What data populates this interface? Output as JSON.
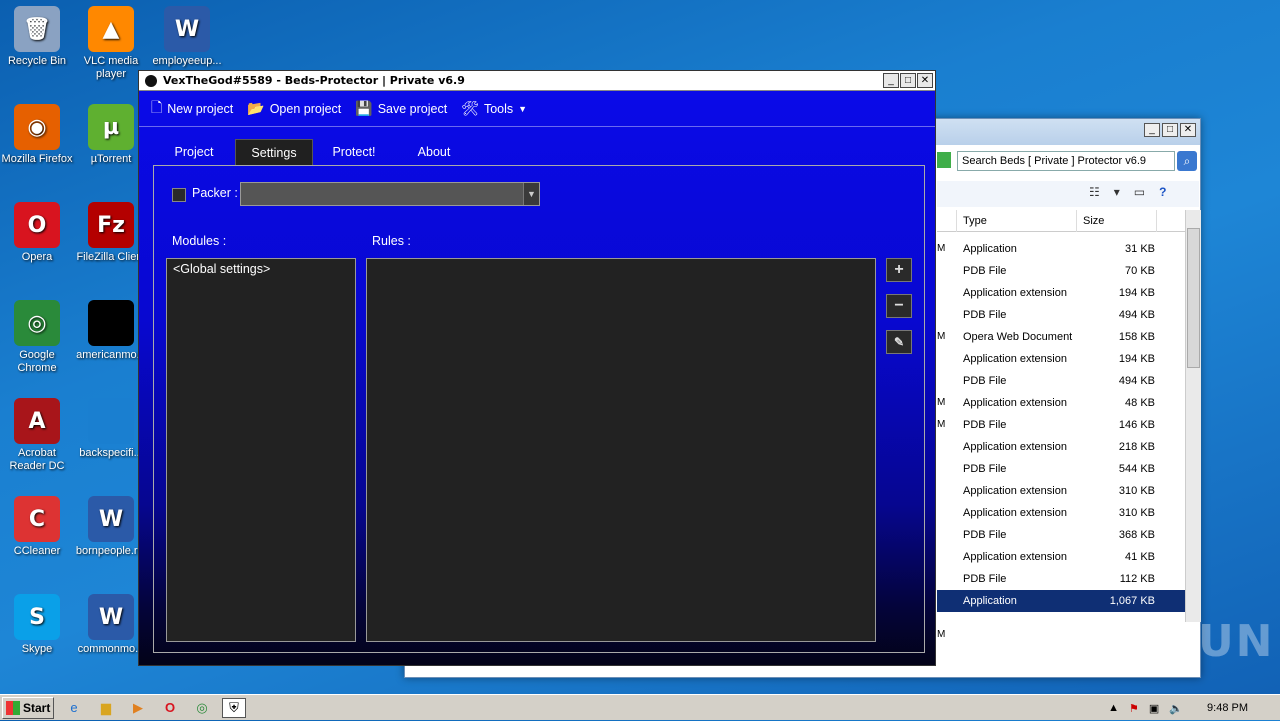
{
  "desktop": {
    "icons": [
      {
        "label": "Recycle Bin",
        "icon": "recycle-bin-icon",
        "glyph": "🗑",
        "color": "#8aa2c2"
      },
      {
        "label": "VLC media player",
        "icon": "vlc-icon",
        "glyph": "▲",
        "color": "#ff8800"
      },
      {
        "label": "employeeup...",
        "icon": "word-doc-icon",
        "glyph": "W",
        "color": "#2b5aa8"
      },
      {
        "label": "Mozilla Firefox",
        "icon": "firefox-icon",
        "glyph": "◉",
        "color": "#e66000"
      },
      {
        "label": "µTorrent",
        "icon": "utorrent-icon",
        "glyph": "µ",
        "color": "#5fb030"
      },
      {
        "label": "Opera",
        "icon": "opera-icon",
        "glyph": "O",
        "color": "#d8141f"
      },
      {
        "label": "FileZilla Client",
        "icon": "filezilla-icon",
        "glyph": "Fz",
        "color": "#b40000"
      },
      {
        "label": "Google Chrome",
        "icon": "chrome-icon",
        "glyph": "◎",
        "color": "#2a8a3a"
      },
      {
        "label": "americanmo...",
        "icon": "black-file-icon",
        "glyph": "",
        "color": "#000000"
      },
      {
        "label": "Acrobat Reader DC",
        "icon": "acrobat-icon",
        "glyph": "A",
        "color": "#a8151a"
      },
      {
        "label": "backspecifi...",
        "icon": "blank-file-icon",
        "glyph": "",
        "color": "#1a7fd0"
      },
      {
        "label": "CCleaner",
        "icon": "ccleaner-icon",
        "glyph": "C",
        "color": "#d33"
      },
      {
        "label": "bornpeople.r...",
        "icon": "word-doc-icon",
        "glyph": "W",
        "color": "#2b5aa8"
      },
      {
        "label": "Skype",
        "icon": "skype-icon",
        "glyph": "S",
        "color": "#0aa0e8"
      },
      {
        "label": "commonmo...",
        "icon": "word-doc-icon",
        "glyph": "W",
        "color": "#2b5aa8"
      }
    ]
  },
  "explorer": {
    "search_placeholder": "Search Beds [ Private ] Protector v6.9",
    "col_type": "Type",
    "col_size": "Size",
    "rows": [
      {
        "m": "M",
        "type": "Application",
        "size": "31 KB"
      },
      {
        "m": "",
        "type": "PDB File",
        "size": "70 KB"
      },
      {
        "m": "",
        "type": "Application extension",
        "size": "194 KB"
      },
      {
        "m": "",
        "type": "PDB File",
        "size": "494 KB"
      },
      {
        "m": "M",
        "type": "Opera Web Document",
        "size": "158 KB"
      },
      {
        "m": "",
        "type": "Application extension",
        "size": "194 KB"
      },
      {
        "m": "",
        "type": "PDB File",
        "size": "494 KB"
      },
      {
        "m": "M",
        "type": "Application extension",
        "size": "48 KB"
      },
      {
        "m": "M",
        "type": "PDB File",
        "size": "146 KB"
      },
      {
        "m": "",
        "type": "Application extension",
        "size": "218 KB"
      },
      {
        "m": "",
        "type": "PDB File",
        "size": "544 KB"
      },
      {
        "m": "",
        "type": "Application extension",
        "size": "310 KB"
      },
      {
        "m": "",
        "type": "Application extension",
        "size": "310 KB"
      },
      {
        "m": "",
        "type": "PDB File",
        "size": "368 KB"
      },
      {
        "m": "",
        "type": "Application extension",
        "size": "41 KB"
      },
      {
        "m": "",
        "type": "PDB File",
        "size": "112 KB"
      },
      {
        "m": "",
        "type": "Application",
        "size": "1,067 KB",
        "selected": true
      }
    ],
    "status_char": "M"
  },
  "app": {
    "title": "VexTheGod#5589 - Beds-Protector | Private v6.9",
    "menu": {
      "new_project": "New project",
      "open_project": "Open project",
      "save_project": "Save project",
      "tools": "Tools"
    },
    "tabs": [
      "Project",
      "Settings",
      "Protect!",
      "About"
    ],
    "active_tab": "Settings",
    "settings": {
      "packer_label": "Packer :",
      "modules_label": "Modules :",
      "rules_label": "Rules :",
      "modules": [
        "<Global settings>"
      ]
    }
  },
  "taskbar": {
    "start_label": "Start",
    "time": "9:48 PM"
  },
  "watermark": "ANY RUN"
}
